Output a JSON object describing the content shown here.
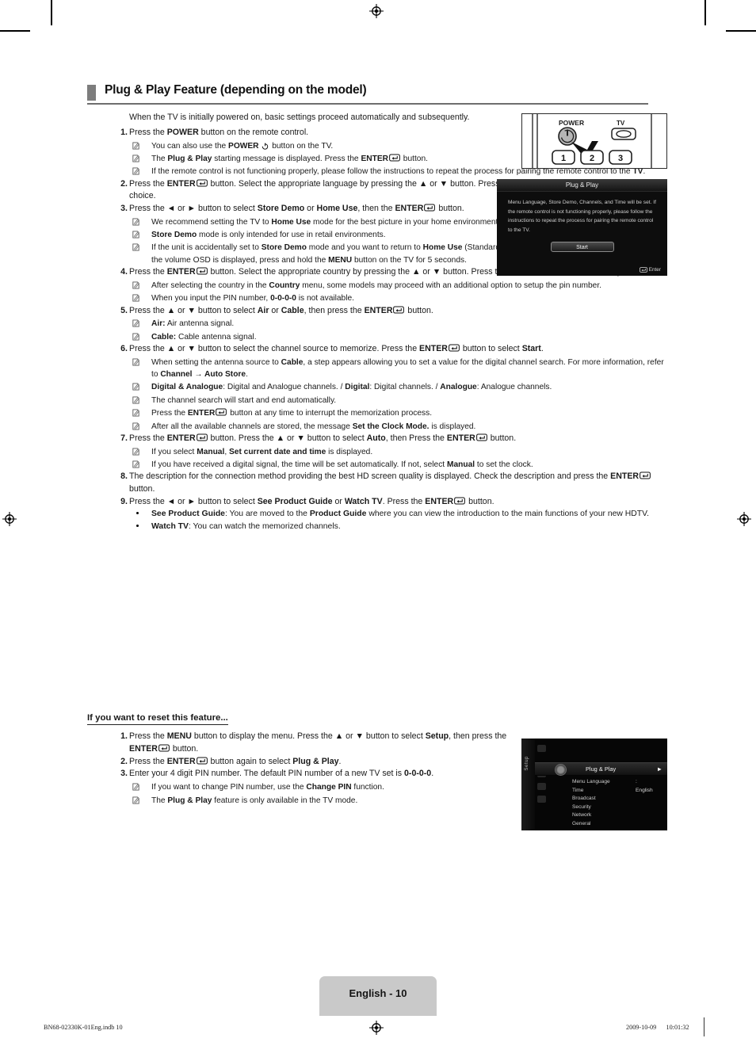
{
  "document": {
    "section_title": "Plug & Play Feature (depending on the model)",
    "intro": "When the TV is initially powered on, basic settings proceed automatically and subsequently.",
    "reset_heading": "If you want to reset this feature...",
    "page_label": "English - 10",
    "footer_left": "BN68-02330K-01Eng.indb   10",
    "footer_right": "2009-10-09      10:01:32"
  },
  "steps": [
    {
      "num": "1.",
      "text_html": "Press the <b>POWER</b> button on the remote control.",
      "notes": [
        {
          "html": "You can also use the <b>POWER</b> <span class=\"pwrglyph\" data-name=\"power-icon\" data-interactable=\"false\"><svg width=\"9\" height=\"9\" viewBox=\"0 0 12 12\"><circle cx=\"6\" cy=\"6.6\" r=\"4.3\" fill=\"none\" stroke=\"#111\" stroke-width=\"1.3\" stroke-dasharray=\"20 7\" transform=\"rotate(-90 6 6.6)\"/><rect x=\"5.35\" y=\"0.8\" width=\"1.3\" height=\"5\" fill=\"#111\"/></svg></span> button on the TV."
        },
        {
          "html": "The <b>Plug &amp; Play</b> starting message is displayed. Press the <b>ENTER</b><span class=\"keyglyph\" data-name=\"enter-key-icon\" data-interactable=\"false\"><svg width=\"14\" height=\"10\" viewBox=\"0 0 18 12\"><rect x=\"0.8\" y=\"0.8\" width=\"16.4\" height=\"10.4\" rx=\"2.4\" fill=\"none\" stroke=\"#111\" stroke-width=\"1.3\"/><path d=\"M13.2 3.4 L13.2 7.2 L6.4 7.2\" fill=\"none\" stroke=\"#111\" stroke-width=\"1.3\"/><path d=\"M7.6 4.7 L4.6 7.2 L7.6 9.4 Z\" fill=\"#111\"/></svg></span> button."
        },
        {
          "html": "If the remote control is not functioning properly, please follow the instructions to repeat the process for pairing the remote control to the <b>TV</b>."
        }
      ]
    },
    {
      "num": "2.",
      "text_html": "Press the <b>ENTER</b><span class=\"keyglyph\" data-name=\"enter-key-icon\" data-interactable=\"false\"><svg width=\"14\" height=\"10\" viewBox=\"0 0 18 12\"><rect x=\"0.8\" y=\"0.8\" width=\"16.4\" height=\"10.4\" rx=\"2.4\" fill=\"none\" stroke=\"#111\" stroke-width=\"1.3\"/><path d=\"M13.2 3.4 L13.2 7.2 L6.4 7.2\" fill=\"none\" stroke=\"#111\" stroke-width=\"1.3\"/><path d=\"M7.6 4.7 L4.6 7.2 L7.6 9.4 Z\" fill=\"#111\"/></svg></span> button. Select the appropriate language by pressing the <b>▲</b> or <b>▼</b> button. Press the <b>ENTER</b><span class=\"keyglyph\" data-name=\"enter-key-icon\" data-interactable=\"false\"><svg width=\"14\" height=\"10\" viewBox=\"0 0 18 12\"><rect x=\"0.8\" y=\"0.8\" width=\"16.4\" height=\"10.4\" rx=\"2.4\" fill=\"none\" stroke=\"#111\" stroke-width=\"1.3\"/><path d=\"M13.2 3.4 L13.2 7.2 L6.4 7.2\" fill=\"none\" stroke=\"#111\" stroke-width=\"1.3\"/><path d=\"M7.6 4.7 L4.6 7.2 L7.6 9.4 Z\" fill=\"#111\"/></svg></span> button to confirm your choice.",
      "notes": []
    },
    {
      "num": "3.",
      "text_html": "Press the <b>◄</b> or <b>►</b> button to select <b>Store Demo</b> or <b>Home Use</b>, then the <b>ENTER</b><span class=\"keyglyph\" data-name=\"enter-key-icon\" data-interactable=\"false\"><svg width=\"14\" height=\"10\" viewBox=\"0 0 18 12\"><rect x=\"0.8\" y=\"0.8\" width=\"16.4\" height=\"10.4\" rx=\"2.4\" fill=\"none\" stroke=\"#111\" stroke-width=\"1.3\"/><path d=\"M13.2 3.4 L13.2 7.2 L6.4 7.2\" fill=\"none\" stroke=\"#111\" stroke-width=\"1.3\"/><path d=\"M7.6 4.7 L4.6 7.2 L7.6 9.4 Z\" fill=\"#111\"/></svg></span> button.",
      "notes": [
        {
          "html": "We recommend setting the TV to <b>Home Use</b> mode for the best picture in your home environment."
        },
        {
          "html": "<b>Store Demo</b> mode is only intended for use in retail environments."
        },
        {
          "html": "If the unit is accidentally set to <b>Store Demo</b> mode and you want to return to <b>Home Use</b> (Standard): Press the volume button on the TV. When the volume OSD is displayed, press and hold the <b>MENU</b> button on the TV for 5 seconds."
        }
      ]
    },
    {
      "num": "4.",
      "text_html": "Press the <b>ENTER</b><span class=\"keyglyph\" data-name=\"enter-key-icon\" data-interactable=\"false\"><svg width=\"14\" height=\"10\" viewBox=\"0 0 18 12\"><rect x=\"0.8\" y=\"0.8\" width=\"16.4\" height=\"10.4\" rx=\"2.4\" fill=\"none\" stroke=\"#111\" stroke-width=\"1.3\"/><path d=\"M13.2 3.4 L13.2 7.2 L6.4 7.2\" fill=\"none\" stroke=\"#111\" stroke-width=\"1.3\"/><path d=\"M7.6 4.7 L4.6 7.2 L7.6 9.4 Z\" fill=\"#111\"/></svg></span> button. Select the appropriate country by pressing the ▲ or ▼ button. Press the <b>ENTER</b><span class=\"keyglyph\" data-name=\"enter-key-icon\" data-interactable=\"false\"><svg width=\"14\" height=\"10\" viewBox=\"0 0 18 12\"><rect x=\"0.8\" y=\"0.8\" width=\"16.4\" height=\"10.4\" rx=\"2.4\" fill=\"none\" stroke=\"#111\" stroke-width=\"1.3\"/><path d=\"M13.2 3.4 L13.2 7.2 L6.4 7.2\" fill=\"none\" stroke=\"#111\" stroke-width=\"1.3\"/><path d=\"M7.6 4.7 L4.6 7.2 L7.6 9.4 Z\" fill=\"#111\"/></svg></span> button to confirm your choice.",
      "notes": [
        {
          "html": "After selecting the country in the <b>Country</b> menu, some models may proceed with an additional option to setup the pin number."
        },
        {
          "html": "When you input the PIN number, <b>0-0-0-0</b> is not available."
        }
      ]
    },
    {
      "num": "5.",
      "text_html": "Press the ▲ or ▼ button to select <b>Air</b> or <b>Cable</b>, then press the <b>ENTER</b><span class=\"keyglyph\" data-name=\"enter-key-icon\" data-interactable=\"false\"><svg width=\"14\" height=\"10\" viewBox=\"0 0 18 12\"><rect x=\"0.8\" y=\"0.8\" width=\"16.4\" height=\"10.4\" rx=\"2.4\" fill=\"none\" stroke=\"#111\" stroke-width=\"1.3\"/><path d=\"M13.2 3.4 L13.2 7.2 L6.4 7.2\" fill=\"none\" stroke=\"#111\" stroke-width=\"1.3\"/><path d=\"M7.6 4.7 L4.6 7.2 L7.6 9.4 Z\" fill=\"#111\"/></svg></span> button.",
      "notes": [
        {
          "html": "<b>Air:</b> Air antenna signal."
        },
        {
          "html": "<b>Cable:</b> Cable antenna signal."
        }
      ]
    },
    {
      "num": "6.",
      "text_html": "Press the ▲ or ▼ button to select the channel source to memorize. Press the <b>ENTER</b><span class=\"keyglyph\" data-name=\"enter-key-icon\" data-interactable=\"false\"><svg width=\"14\" height=\"10\" viewBox=\"0 0 18 12\"><rect x=\"0.8\" y=\"0.8\" width=\"16.4\" height=\"10.4\" rx=\"2.4\" fill=\"none\" stroke=\"#111\" stroke-width=\"1.3\"/><path d=\"M13.2 3.4 L13.2 7.2 L6.4 7.2\" fill=\"none\" stroke=\"#111\" stroke-width=\"1.3\"/><path d=\"M7.6 4.7 L4.6 7.2 L7.6 9.4 Z\" fill=\"#111\"/></svg></span> button to select <b>Start</b>.",
      "notes": [
        {
          "html": "When setting the antenna source to <b>Cable</b>, a step appears allowing you to set a value for the digital channel search. For more information, refer to <b>Channel → Auto Store</b>."
        },
        {
          "html": "<b>Digital &amp; Analogue</b>: Digital and Analogue channels. / <b>Digital</b>: Digital channels. / <b>Analogue</b>: Analogue channels."
        },
        {
          "html": "The channel search will start and end automatically."
        },
        {
          "html": "Press the <b>ENTER</b><span class=\"keyglyph\" data-name=\"enter-key-icon\" data-interactable=\"false\"><svg width=\"14\" height=\"10\" viewBox=\"0 0 18 12\"><rect x=\"0.8\" y=\"0.8\" width=\"16.4\" height=\"10.4\" rx=\"2.4\" fill=\"none\" stroke=\"#111\" stroke-width=\"1.3\"/><path d=\"M13.2 3.4 L13.2 7.2 L6.4 7.2\" fill=\"none\" stroke=\"#111\" stroke-width=\"1.3\"/><path d=\"M7.6 4.7 L4.6 7.2 L7.6 9.4 Z\" fill=\"#111\"/></svg></span> button at any time to interrupt the memorization process."
        },
        {
          "html": "After all the available channels are stored, the message <b>Set the Clock Mode.</b> is displayed."
        }
      ]
    },
    {
      "num": "7.",
      "text_html": "Press the <b>ENTER</b><span class=\"keyglyph\" data-name=\"enter-key-icon\" data-interactable=\"false\"><svg width=\"14\" height=\"10\" viewBox=\"0 0 18 12\"><rect x=\"0.8\" y=\"0.8\" width=\"16.4\" height=\"10.4\" rx=\"2.4\" fill=\"none\" stroke=\"#111\" stroke-width=\"1.3\"/><path d=\"M13.2 3.4 L13.2 7.2 L6.4 7.2\" fill=\"none\" stroke=\"#111\" stroke-width=\"1.3\"/><path d=\"M7.6 4.7 L4.6 7.2 L7.6 9.4 Z\" fill=\"#111\"/></svg></span> button. Press the ▲ or ▼ button to select <b>Auto</b>, then Press the <b>ENTER</b><span class=\"keyglyph\" data-name=\"enter-key-icon\" data-interactable=\"false\"><svg width=\"14\" height=\"10\" viewBox=\"0 0 18 12\"><rect x=\"0.8\" y=\"0.8\" width=\"16.4\" height=\"10.4\" rx=\"2.4\" fill=\"none\" stroke=\"#111\" stroke-width=\"1.3\"/><path d=\"M13.2 3.4 L13.2 7.2 L6.4 7.2\" fill=\"none\" stroke=\"#111\" stroke-width=\"1.3\"/><path d=\"M7.6 4.7 L4.6 7.2 L7.6 9.4 Z\" fill=\"#111\"/></svg></span> button.",
      "notes": [
        {
          "html": "If you select <b>Manual</b>, <b>Set current date and time</b> is displayed."
        },
        {
          "html": "If you have received a digital signal, the time will be set automatically. If not, select <b>Manual</b> to set the clock."
        }
      ]
    },
    {
      "num": "8.",
      "text_html": "The description for the connection method providing the best HD screen quality is displayed. Check the description and press the <b>ENTER</b><span class=\"keyglyph\" data-name=\"enter-key-icon\" data-interactable=\"false\"><svg width=\"14\" height=\"10\" viewBox=\"0 0 18 12\"><rect x=\"0.8\" y=\"0.8\" width=\"16.4\" height=\"10.4\" rx=\"2.4\" fill=\"none\" stroke=\"#111\" stroke-width=\"1.3\"/><path d=\"M13.2 3.4 L13.2 7.2 L6.4 7.2\" fill=\"none\" stroke=\"#111\" stroke-width=\"1.3\"/><path d=\"M7.6 4.7 L4.6 7.2 L7.6 9.4 Z\" fill=\"#111\"/></svg></span> button.",
      "notes": []
    },
    {
      "num": "9.",
      "text_html": "Press the ◄ or ► button to select <b>See Product Guide</b> or <b>Watch TV</b>. Press the <b>ENTER</b><span class=\"keyglyph\" data-name=\"enter-key-icon\" data-interactable=\"false\"><svg width=\"14\" height=\"10\" viewBox=\"0 0 18 12\"><rect x=\"0.8\" y=\"0.8\" width=\"16.4\" height=\"10.4\" rx=\"2.4\" fill=\"none\" stroke=\"#111\" stroke-width=\"1.3\"/><path d=\"M13.2 3.4 L13.2 7.2 L6.4 7.2\" fill=\"none\" stroke=\"#111\" stroke-width=\"1.3\"/><path d=\"M7.6 4.7 L4.6 7.2 L7.6 9.4 Z\" fill=\"#111\"/></svg></span> button.",
      "bullets": [
        {
          "html": "<b>See Product Guide</b>: You are moved to the <b>Product Guide</b> where you can view the introduction to the main functions of your new HDTV."
        },
        {
          "html": "<b>Watch TV</b>: You can watch the memorized channels."
        }
      ],
      "notes": []
    }
  ],
  "reset_steps": [
    {
      "num": "1.",
      "text_html": "Press the <b>MENU</b> button to display the menu. Press the ▲ or ▼ button to select <b>Setup</b>, then press the <b>ENTER</b><span class=\"keyglyph\" data-name=\"enter-key-icon\" data-interactable=\"false\"><svg width=\"14\" height=\"10\" viewBox=\"0 0 18 12\"><rect x=\"0.8\" y=\"0.8\" width=\"16.4\" height=\"10.4\" rx=\"2.4\" fill=\"none\" stroke=\"#111\" stroke-width=\"1.3\"/><path d=\"M13.2 3.4 L13.2 7.2 L6.4 7.2\" fill=\"none\" stroke=\"#111\" stroke-width=\"1.3\"/><path d=\"M7.6 4.7 L4.6 7.2 L7.6 9.4 Z\" fill=\"#111\"/></svg></span> button.",
      "notes": []
    },
    {
      "num": "2.",
      "text_html": "Press the <b>ENTER</b><span class=\"keyglyph\" data-name=\"enter-key-icon\" data-interactable=\"false\"><svg width=\"14\" height=\"10\" viewBox=\"0 0 18 12\"><rect x=\"0.8\" y=\"0.8\" width=\"16.4\" height=\"10.4\" rx=\"2.4\" fill=\"none\" stroke=\"#111\" stroke-width=\"1.3\"/><path d=\"M13.2 3.4 L13.2 7.2 L6.4 7.2\" fill=\"none\" stroke=\"#111\" stroke-width=\"1.3\"/><path d=\"M7.6 4.7 L4.6 7.2 L7.6 9.4 Z\" fill=\"#111\"/></svg></span> button again to select <b>Plug &amp; Play</b>.",
      "notes": []
    },
    {
      "num": "3.",
      "text_html": "Enter your 4 digit PIN number. The default PIN number of a new TV set is <b>0-0-0-0</b>.",
      "notes": [
        {
          "html": "If you want to change PIN number, use the <b>Change PIN</b> function."
        },
        {
          "html": "The <b>Plug &amp; Play</b> feature is only available in the TV mode."
        }
      ]
    }
  ],
  "figures": {
    "remote": {
      "power_label": "POWER",
      "tv_label": "TV",
      "keys": [
        "1",
        "2",
        "3"
      ]
    },
    "osd_dialog": {
      "title": "Plug & Play",
      "body": "Menu Language, Store Demo, Channels, and Time will be set. If the remote control is not functioning properly, please follow the instructions to repeat the process for pairing the remote control to the TV.",
      "start_label": "Start",
      "enter_label": "Enter"
    },
    "setup_menu": {
      "rail_label": "Setup",
      "selected_item": "Plug & Play",
      "items": [
        {
          "label": "Menu Language",
          "value": ": English"
        },
        {
          "label": "Time",
          "value": ""
        },
        {
          "label": "Broadcast",
          "value": ""
        },
        {
          "label": "Security",
          "value": ""
        },
        {
          "label": "Network",
          "value": ""
        },
        {
          "label": "General",
          "value": ""
        }
      ]
    }
  }
}
